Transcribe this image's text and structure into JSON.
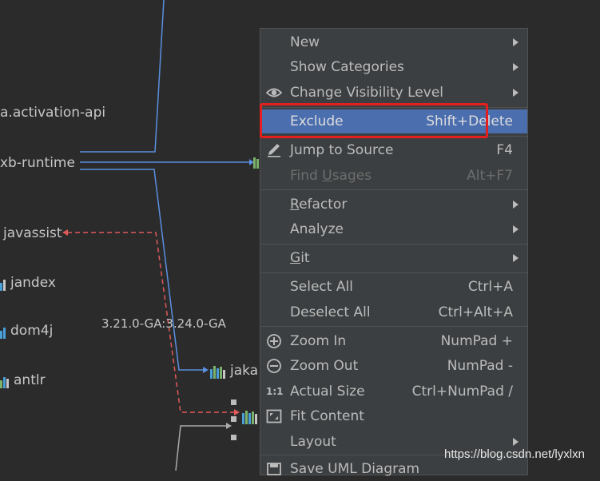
{
  "diagram": {
    "nodes": [
      {
        "id": "activation",
        "label": "a.activation-api"
      },
      {
        "id": "runtime",
        "label": "xb-runtime"
      },
      {
        "id": "javassist",
        "label": "javassist"
      },
      {
        "id": "jandex",
        "label": "jandex"
      },
      {
        "id": "dom4j",
        "label": "dom4j"
      },
      {
        "id": "antlr",
        "label": "antlr"
      },
      {
        "id": "jaka",
        "label": "jaka"
      }
    ],
    "edge_label": "3.21.0-GA:3.24.0-GA"
  },
  "menu": {
    "items": [
      {
        "label": "New",
        "submenu": true
      },
      {
        "label": "Show Categories",
        "submenu": true
      },
      {
        "label": "Change Visibility Level",
        "submenu": true,
        "icon": "eye-icon"
      },
      {
        "label": "Exclude",
        "shortcut": "Shift+Delete",
        "selected": true
      },
      {
        "label": "Jump to Source",
        "shortcut": "F4",
        "icon": "pencil-icon"
      },
      {
        "label": "Find Usages",
        "shortcut": "Alt+F7",
        "disabled": true
      },
      {
        "label": "Refactor",
        "submenu": true
      },
      {
        "label": "Analyze",
        "submenu": true
      },
      {
        "label": "Git",
        "submenu": true
      },
      {
        "label": "Select All",
        "shortcut": "Ctrl+A"
      },
      {
        "label": "Deselect All",
        "shortcut": "Ctrl+Alt+A"
      },
      {
        "label": "Zoom In",
        "shortcut": "NumPad +",
        "icon": "zoom-in-icon"
      },
      {
        "label": "Zoom Out",
        "shortcut": "NumPad -",
        "icon": "zoom-out-icon"
      },
      {
        "label": "Actual Size",
        "shortcut": "Ctrl+NumPad /",
        "icon": "actual-size-icon",
        "icon_text": "1:1"
      },
      {
        "label": "Fit Content",
        "icon": "fit-content-icon"
      },
      {
        "label": "Layout",
        "submenu": true
      },
      {
        "label": "Save UML Diagram",
        "icon": "save-icon"
      }
    ]
  },
  "watermark": "https://blog.csdn.net/lyxlxn",
  "colors": {
    "background": "#2b2b2b",
    "menu_bg": "#3c3f41",
    "selection": "#4b6eaf",
    "edge_blue": "#5b8fe0",
    "edge_red": "#e05a5a",
    "annotation_red": "#e31f1f"
  }
}
